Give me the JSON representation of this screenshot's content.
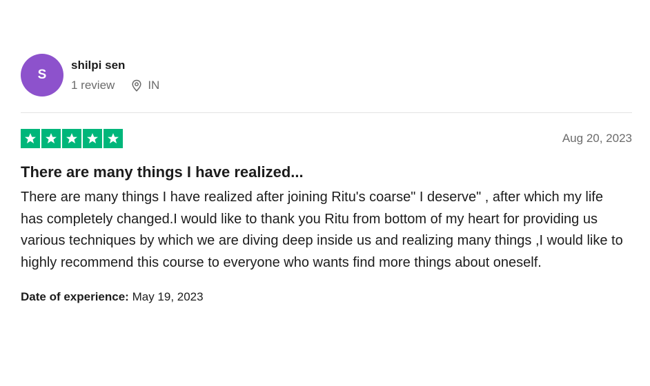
{
  "reviewer": {
    "avatar_initial": "S",
    "avatar_color": "#8d52cc",
    "name": "shilpi sen",
    "review_count": "1 review",
    "location_icon": "location-pin-icon",
    "country": "IN"
  },
  "review": {
    "rating": 5,
    "rating_max": 5,
    "star_color": "#00b67a",
    "date": "Aug 20, 2023",
    "title": "There are many things I have realized...",
    "body": "There are many things I have realized after joining Ritu's coarse\" I deserve\" , after which my life has completely changed.I would like to thank you Ritu from bottom of my heart for providing us various techniques by which we are diving deep inside us and realizing many things ,I would like to highly recommend this course to everyone who wants find more things about oneself.",
    "experience_label": "Date of experience:",
    "experience_date": "May 19, 2023"
  }
}
